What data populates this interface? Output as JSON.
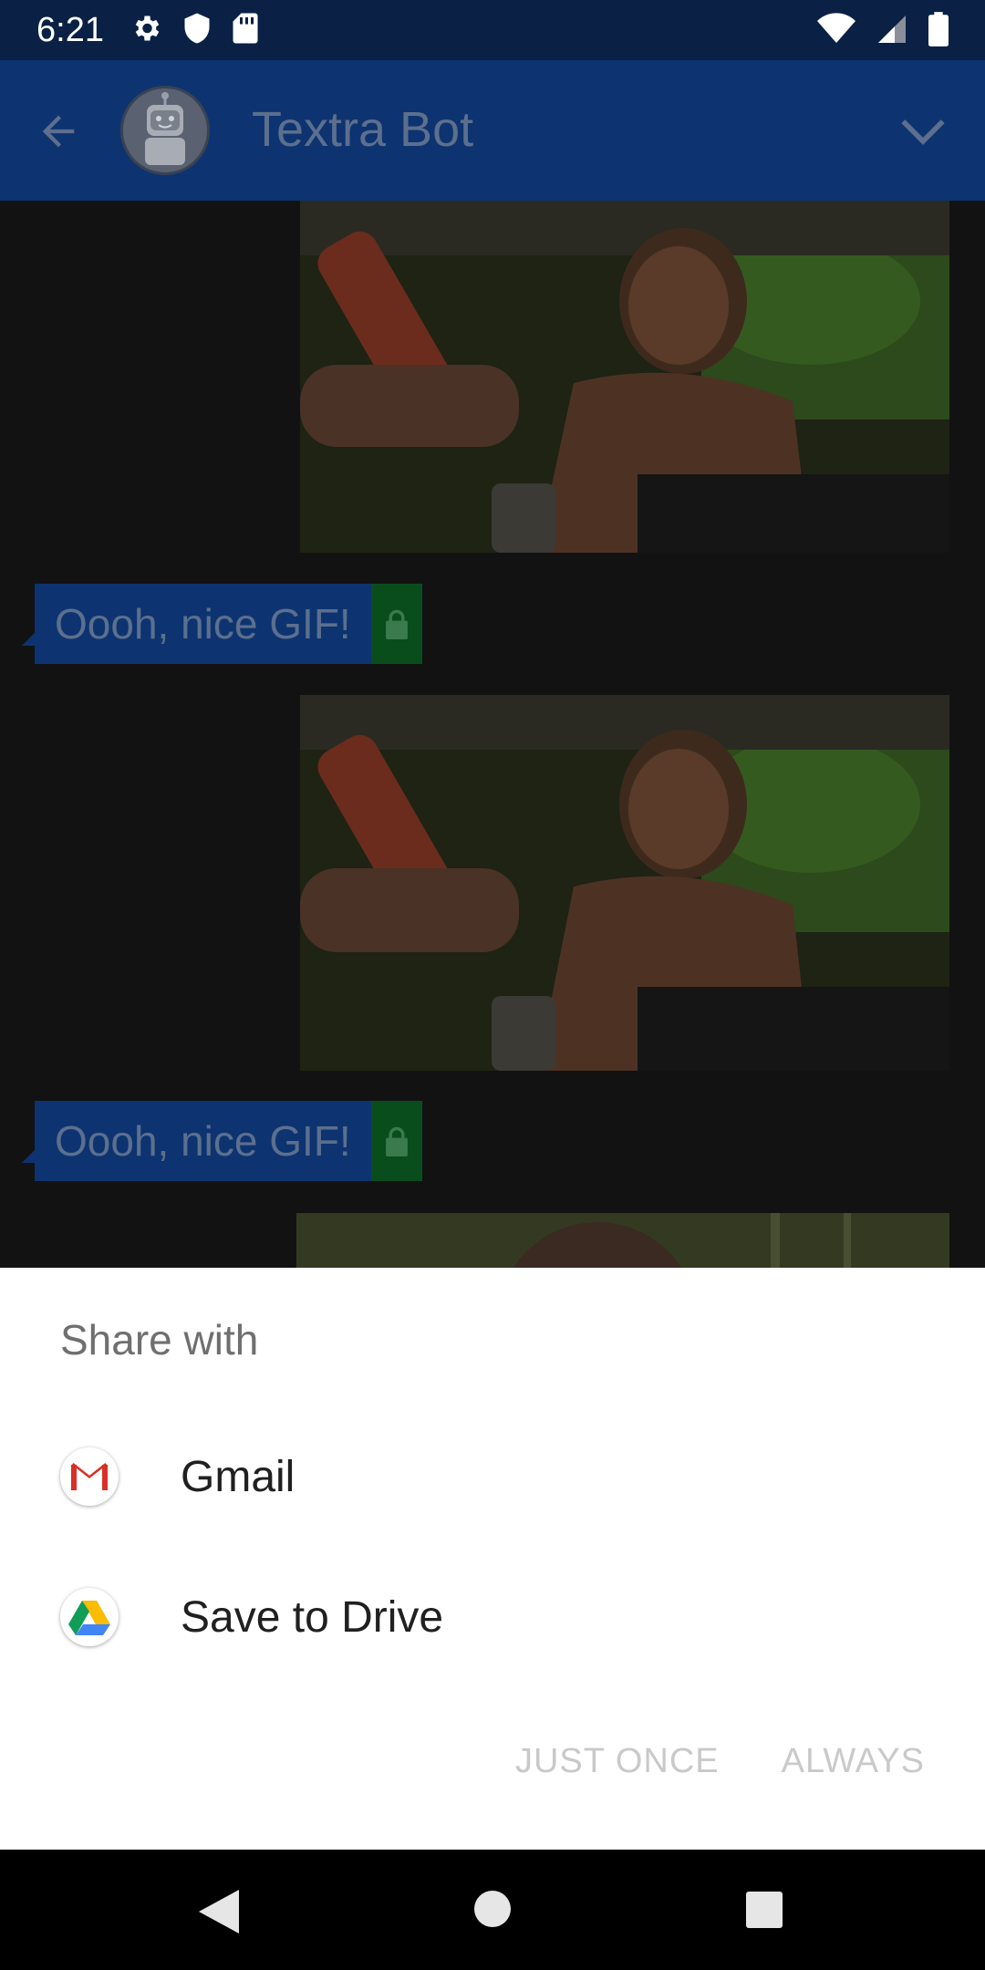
{
  "status_bar": {
    "time": "6:21"
  },
  "header": {
    "title": "Textra Bot"
  },
  "conversation": {
    "messages": [
      {
        "text": "Oooh, nice GIF!"
      },
      {
        "text": "Oooh, nice GIF!"
      }
    ]
  },
  "share_sheet": {
    "title": "Share with",
    "apps": [
      {
        "label": "Gmail",
        "icon": "gmail-icon"
      },
      {
        "label": "Save to Drive",
        "icon": "drive-icon"
      }
    ],
    "actions": {
      "just_once": "JUST ONCE",
      "always": "ALWAYS"
    }
  },
  "colors": {
    "app_bar": "#0d3470",
    "status_bar": "#0a2145",
    "bubble_lock": "#0a4d1d",
    "sheet_bg": "#ffffff"
  }
}
